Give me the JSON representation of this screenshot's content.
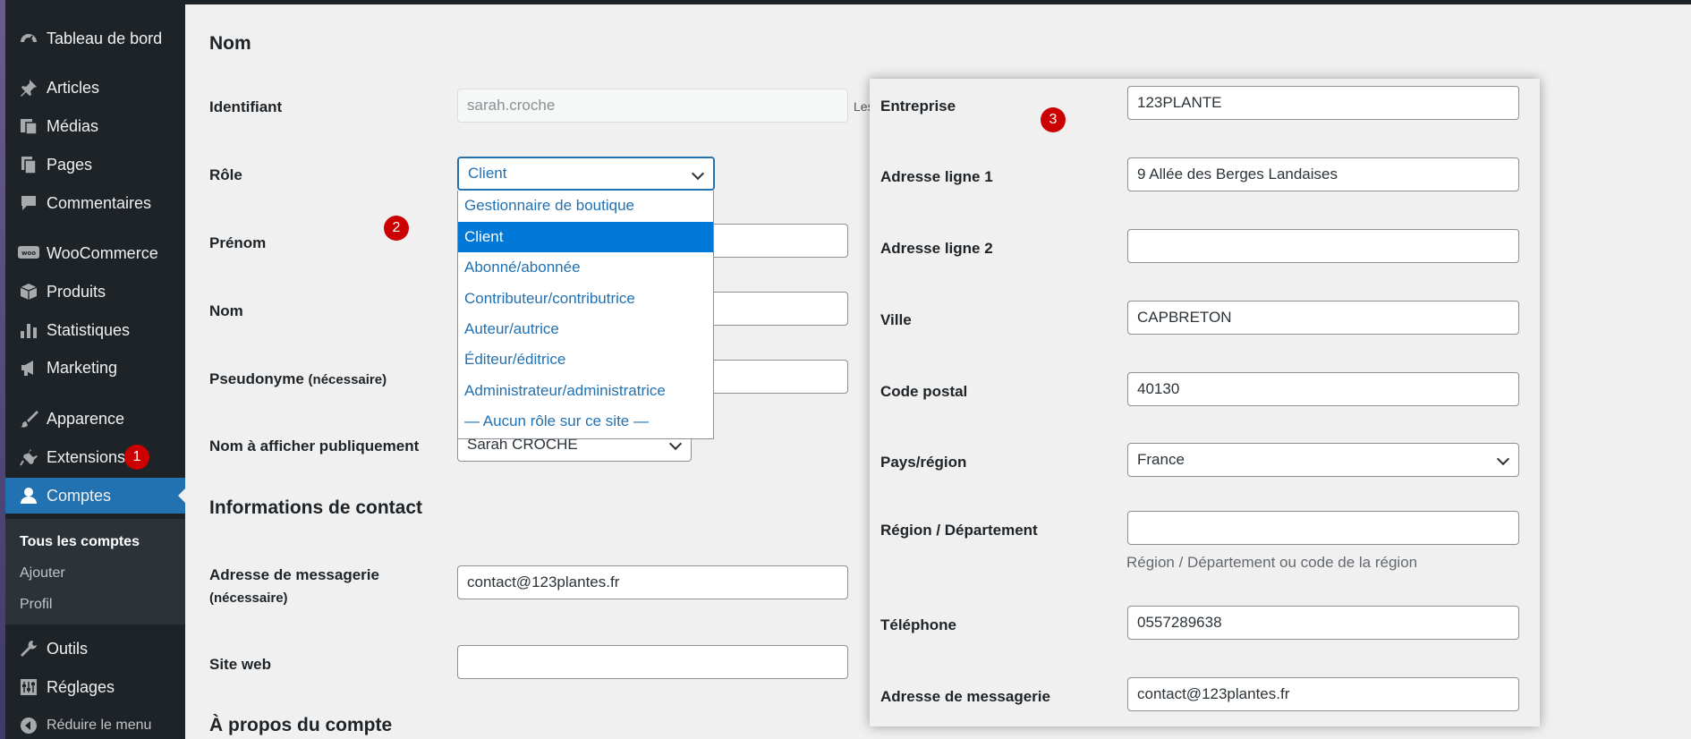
{
  "sidebar": {
    "items": [
      {
        "label": "Tableau de bord",
        "icon": "dashboard-icon"
      },
      {
        "label": "Articles",
        "icon": "pin-icon"
      },
      {
        "label": "Médias",
        "icon": "media-icon"
      },
      {
        "label": "Pages",
        "icon": "pages-icon"
      },
      {
        "label": "Commentaires",
        "icon": "comment-icon"
      },
      {
        "label": "WooCommerce",
        "icon": "woo-icon"
      },
      {
        "label": "Produits",
        "icon": "box-icon"
      },
      {
        "label": "Statistiques",
        "icon": "bar-chart-icon"
      },
      {
        "label": "Marketing",
        "icon": "megaphone-icon"
      },
      {
        "label": "Apparence",
        "icon": "brush-icon"
      },
      {
        "label": "Extensions",
        "icon": "plugin-icon"
      },
      {
        "label": "Comptes",
        "icon": "user-icon"
      },
      {
        "label": "Outils",
        "icon": "wrench-icon"
      },
      {
        "label": "Réglages",
        "icon": "sliders-icon"
      },
      {
        "label": "Réduire le menu",
        "icon": "collapse-icon"
      }
    ],
    "submenu": [
      "Tous les comptes",
      "Ajouter",
      "Profil"
    ]
  },
  "badges": [
    "1",
    "2",
    "3"
  ],
  "main": {
    "section_name": "Nom",
    "section_contact": "Informations de contact",
    "section_about": "À propos du compte",
    "fields": {
      "identifiant_label": "Identifiant",
      "identifiant_value": "sarah.croche",
      "identifiant_note": "Les",
      "role_label": "Rôle",
      "role_value": "Client",
      "prenom_label": "Prénom",
      "nom_label": "Nom",
      "pseudo_label": "Pseudonyme",
      "pseudo_required": "(nécessaire)",
      "display_label": "Nom à afficher publiquement",
      "display_value": "Sarah CROCHE",
      "email_label": "Adresse de messagerie",
      "email_required": "(nécessaire)",
      "email_value": "contact@123plantes.fr",
      "site_label": "Site web"
    },
    "role_options": [
      "Gestionnaire de boutique",
      "Client",
      "Abonné/abonnée",
      "Contributeur/contributrice",
      "Auteur/autrice",
      "Éditeur/éditrice",
      "Administrateur/administratrice",
      "— Aucun rôle sur ce site —"
    ]
  },
  "billing": {
    "company_label": "Entreprise",
    "company_value": "123PLANTE",
    "address1_label": "Adresse ligne 1",
    "address1_value": "9 Allée des Berges Landaises",
    "address2_label": "Adresse ligne 2",
    "address2_value": "",
    "city_label": "Ville",
    "city_value": "CAPBRETON",
    "postcode_label": "Code postal",
    "postcode_value": "40130",
    "country_label": "Pays/région",
    "country_value": "France",
    "state_label": "Région / Département",
    "state_value": "",
    "state_hint": "Région / Département ou code de la région",
    "phone_label": "Téléphone",
    "phone_value": "0557289638",
    "email_label": "Adresse de messagerie",
    "email_value": "contact@123plantes.fr"
  },
  "colors": {
    "sidebar_bg": "#1d2327",
    "submenu_bg": "#2c3338",
    "accent_blue": "#2271b1",
    "option_selected": "#0078d7",
    "badge_red": "#cc0000"
  }
}
